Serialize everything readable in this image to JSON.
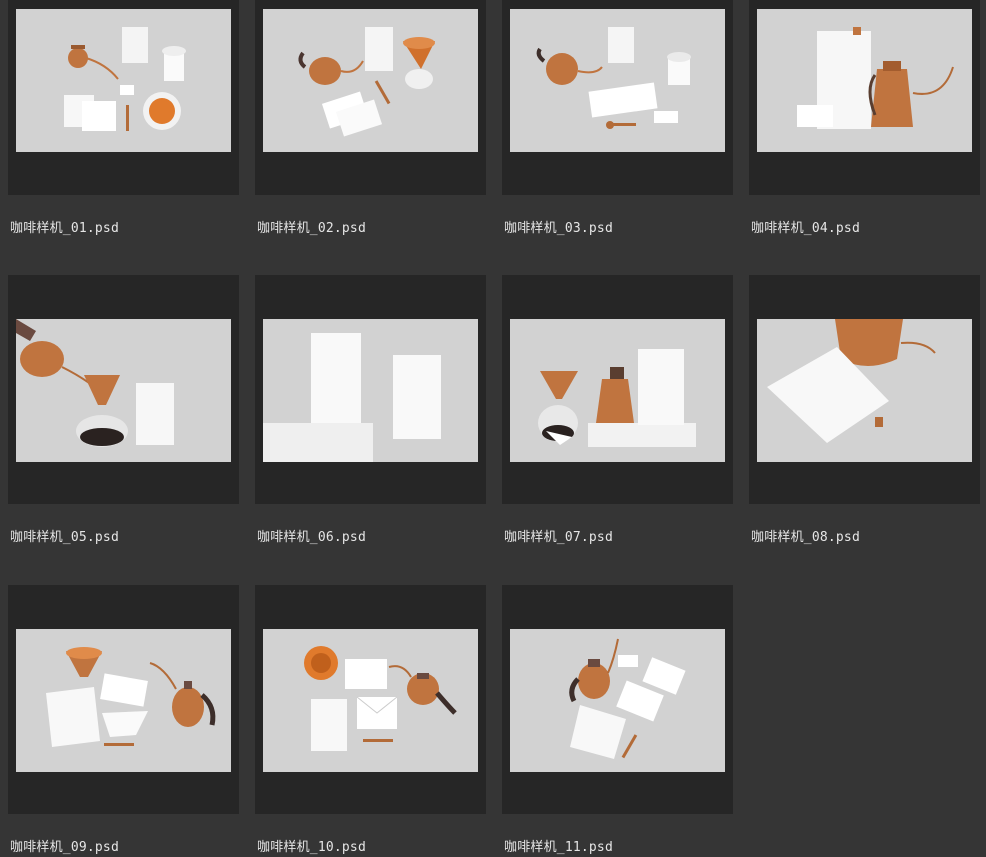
{
  "files": [
    {
      "name": "咖啡样机_01.psd"
    },
    {
      "name": "咖啡样机_02.psd"
    },
    {
      "name": "咖啡样机_03.psd"
    },
    {
      "name": "咖啡样机_04.psd"
    },
    {
      "name": "咖啡样机_05.psd"
    },
    {
      "name": "咖啡样机_06.psd"
    },
    {
      "name": "咖啡样机_07.psd"
    },
    {
      "name": "咖啡样机_08.psd"
    },
    {
      "name": "咖啡样机_09.psd"
    },
    {
      "name": "咖啡样机_10.psd"
    },
    {
      "name": "咖啡样机_11.psd"
    }
  ],
  "colors": {
    "background": "#353535",
    "tile": "#262626",
    "thumb_bg": "#d2d2d2",
    "copper": "#c0743f",
    "label_text": "#e6e6e6"
  }
}
